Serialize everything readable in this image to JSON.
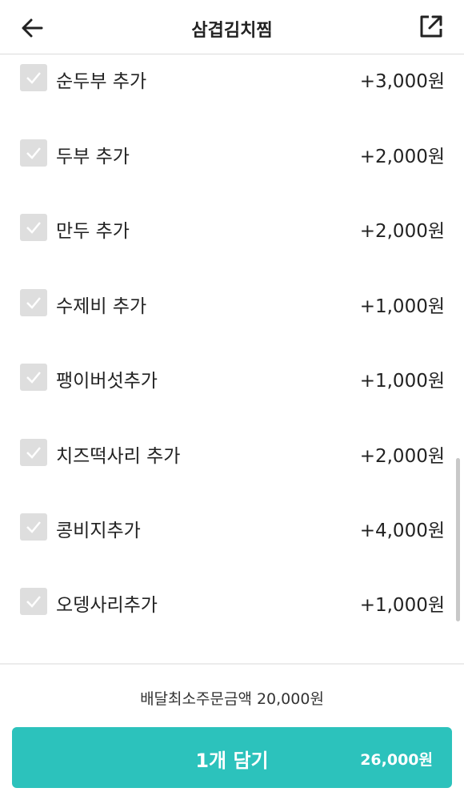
{
  "header": {
    "title": "삼겹김치찜",
    "back_icon": "arrow-left-icon",
    "share_icon": "external-share-icon"
  },
  "options": [
    {
      "label": "순두부 추가",
      "price": "+3,000원"
    },
    {
      "label": "두부 추가",
      "price": "+2,000원"
    },
    {
      "label": "만두 추가",
      "price": "+2,000원"
    },
    {
      "label": "수제비 추가",
      "price": "+1,000원"
    },
    {
      "label": "팽이버섯추가",
      "price": "+1,000원"
    },
    {
      "label": "치즈떡사리 추가",
      "price": "+2,000원"
    },
    {
      "label": "콩비지추가",
      "price": "+4,000원"
    },
    {
      "label": "오뎅사리추가",
      "price": "+1,000원"
    }
  ],
  "footer": {
    "min_order": "배달최소주문금액 20,000원",
    "cart_label": "1개 담기",
    "cart_total": "26,000원"
  },
  "colors": {
    "accent": "#2cc2bc",
    "checkbox": "#dedede"
  }
}
